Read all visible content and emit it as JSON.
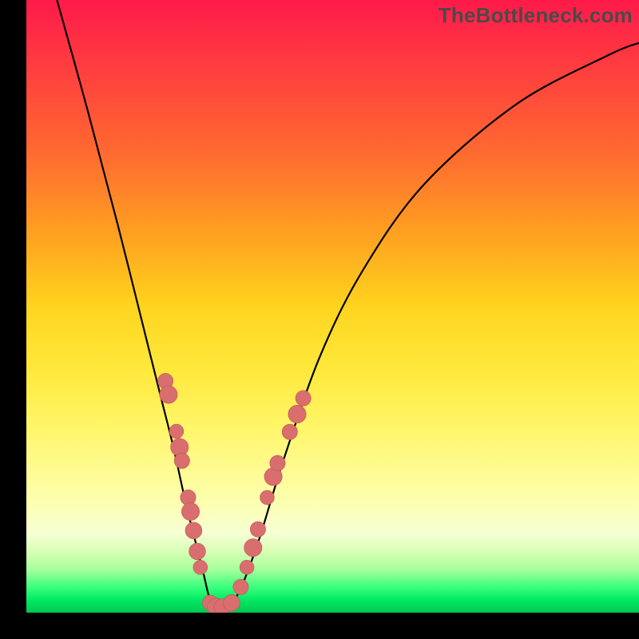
{
  "watermark": "TheBottleneck.com",
  "chart_data": {
    "type": "line",
    "title": "",
    "xlabel": "",
    "ylabel": "",
    "xlim": [
      0,
      100
    ],
    "ylim": [
      0,
      100
    ],
    "grid": false,
    "legend": false,
    "series": [
      {
        "name": "curve",
        "x": [
          5,
          10,
          15,
          20,
          22,
          24,
          26,
          28,
          29,
          30,
          31,
          33,
          35,
          38,
          42,
          48,
          55,
          65,
          80,
          95,
          100
        ],
        "y": [
          100,
          82,
          63,
          43,
          35,
          27,
          18,
          10,
          6,
          2,
          1,
          1,
          4,
          12,
          25,
          42,
          56,
          70,
          83,
          91,
          93
        ]
      }
    ],
    "markers": {
      "name": "beads",
      "points": [
        {
          "x": 22.7,
          "y": 37.8,
          "r": 1.3
        },
        {
          "x": 23.2,
          "y": 35.6,
          "r": 1.5
        },
        {
          "x": 24.5,
          "y": 29.6,
          "r": 1.2
        },
        {
          "x": 25.0,
          "y": 27.0,
          "r": 1.5
        },
        {
          "x": 25.4,
          "y": 24.8,
          "r": 1.3
        },
        {
          "x": 26.4,
          "y": 18.8,
          "r": 1.3
        },
        {
          "x": 26.8,
          "y": 16.5,
          "r": 1.5
        },
        {
          "x": 27.3,
          "y": 13.4,
          "r": 1.4
        },
        {
          "x": 27.9,
          "y": 10.0,
          "r": 1.4
        },
        {
          "x": 28.4,
          "y": 7.4,
          "r": 1.2
        },
        {
          "x": 30.0,
          "y": 1.6,
          "r": 1.3
        },
        {
          "x": 31.0,
          "y": 0.9,
          "r": 1.5
        },
        {
          "x": 32.0,
          "y": 0.9,
          "r": 1.4
        },
        {
          "x": 33.5,
          "y": 1.6,
          "r": 1.4
        },
        {
          "x": 35.0,
          "y": 4.2,
          "r": 1.3
        },
        {
          "x": 36.0,
          "y": 7.4,
          "r": 1.2
        },
        {
          "x": 37.0,
          "y": 10.6,
          "r": 1.5
        },
        {
          "x": 37.8,
          "y": 13.6,
          "r": 1.3
        },
        {
          "x": 39.3,
          "y": 18.8,
          "r": 1.2
        },
        {
          "x": 40.3,
          "y": 22.2,
          "r": 1.5
        },
        {
          "x": 41.0,
          "y": 24.4,
          "r": 1.3
        },
        {
          "x": 43.0,
          "y": 29.5,
          "r": 1.3
        },
        {
          "x": 44.2,
          "y": 32.4,
          "r": 1.5
        },
        {
          "x": 45.2,
          "y": 35.0,
          "r": 1.3
        }
      ]
    }
  }
}
